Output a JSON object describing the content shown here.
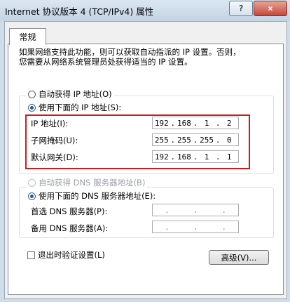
{
  "window": {
    "title": "Internet 协议版本 4 (TCP/IPv4) 属性",
    "help_label": "?",
    "close_label": "×"
  },
  "tab": {
    "label": "常规"
  },
  "description": {
    "line1": "如果网络支持此功能，则可以获取自动指派的 IP 设置。否则，",
    "line2": "您需要从网络系统管理员处获得适当的 IP 设置。"
  },
  "ip_section": {
    "auto_label": "自动获得 IP 地址(O)",
    "manual_label": "使用下面的 IP 地址(S):",
    "mode": "manual",
    "fields": [
      {
        "label": "IP 地址(I):",
        "octets": [
          "192",
          "168",
          "1",
          "2"
        ]
      },
      {
        "label": "子网掩码(U):",
        "octets": [
          "255",
          "255",
          "255",
          "0"
        ]
      },
      {
        "label": "默认网关(D):",
        "octets": [
          "192",
          "168",
          "1",
          "1"
        ]
      }
    ]
  },
  "dns_section": {
    "auto_label": "自动获得 DNS 服务器地址(B)",
    "manual_label": "使用下面的 DNS 服务器地址(E):",
    "mode": "manual",
    "fields": [
      {
        "label": "首选 DNS 服务器(P):",
        "octets": [
          "",
          "",
          "",
          ""
        ]
      },
      {
        "label": "备用 DNS 服务器(A):",
        "octets": [
          "",
          "",
          "",
          ""
        ]
      }
    ]
  },
  "validate_on_exit": {
    "label": "退出时验证设置(L)",
    "checked": false
  },
  "advanced_button": {
    "label": "高级(V)..."
  },
  "colors": {
    "highlight_box": "#d21a1a",
    "radio_dot": "#1d5aa8"
  }
}
